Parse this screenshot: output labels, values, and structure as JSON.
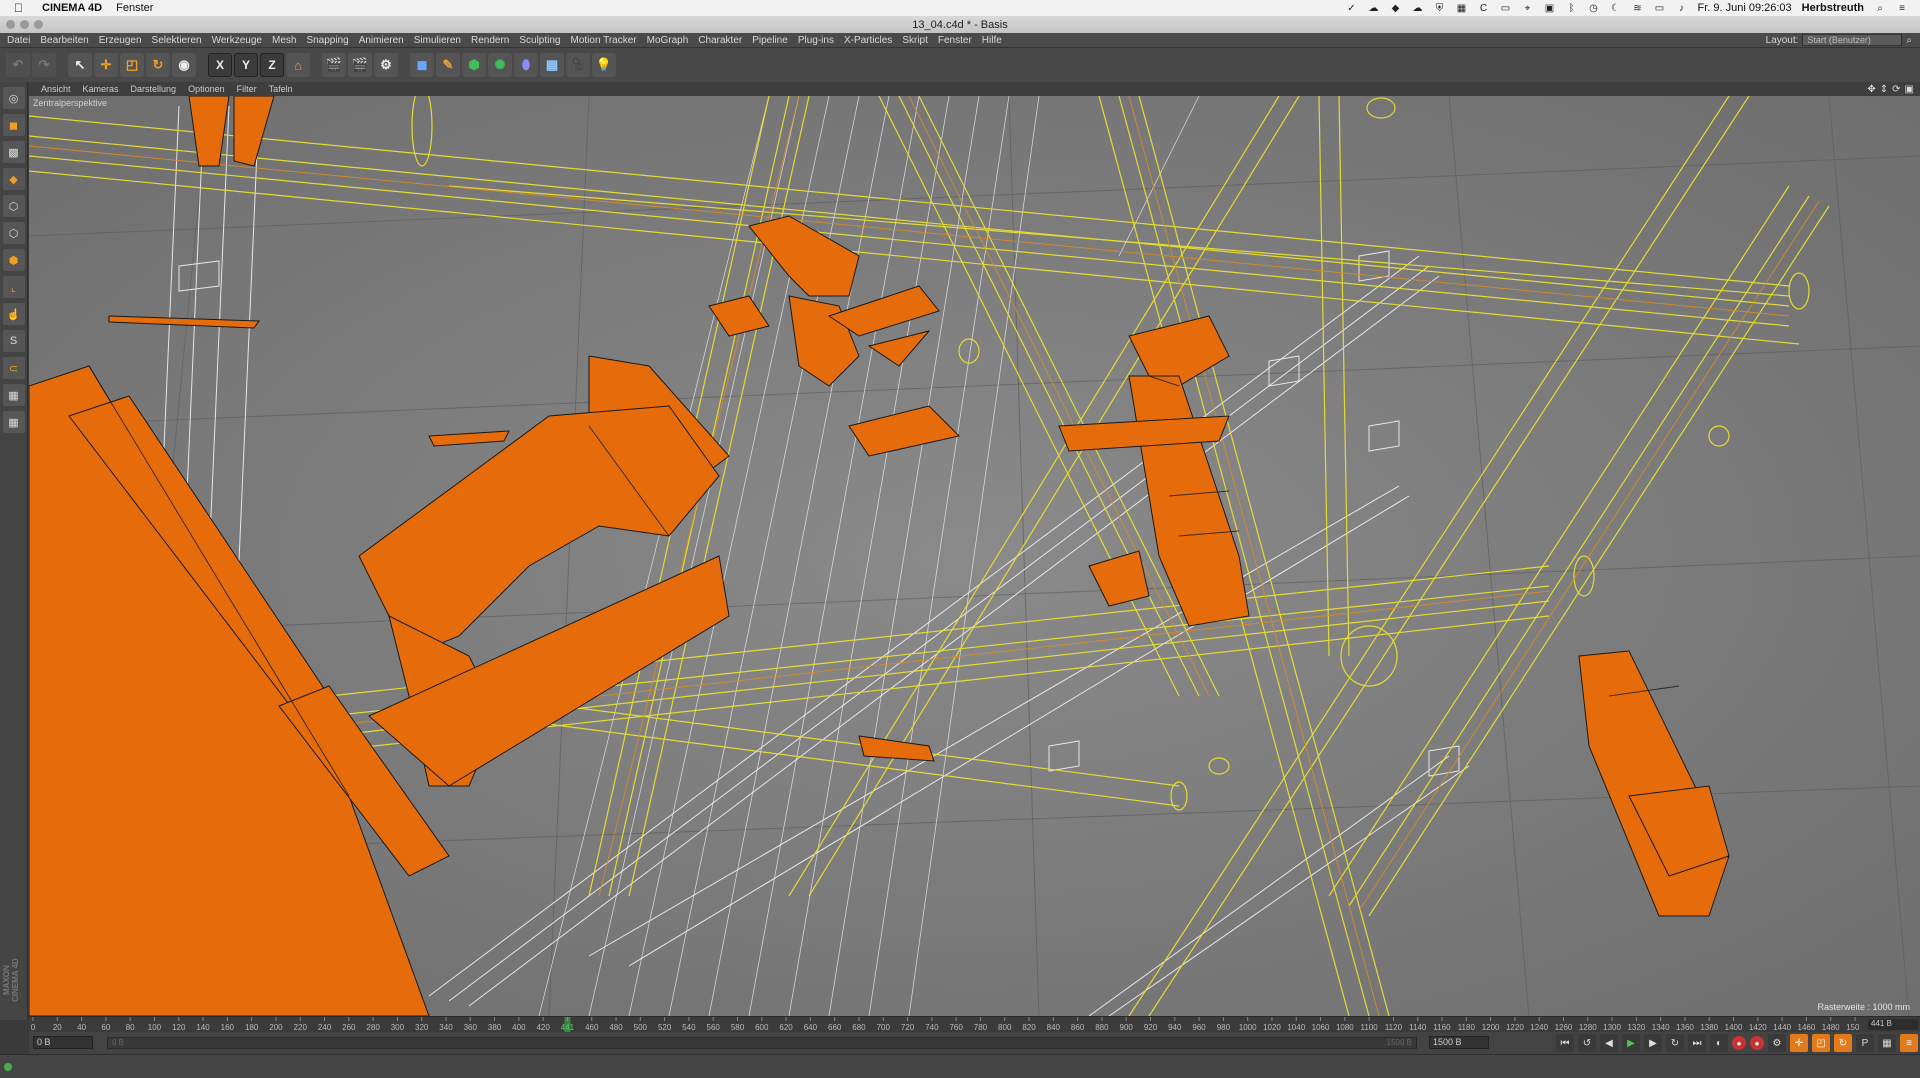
{
  "macos": {
    "app_name": "CINEMA 4D",
    "menu": [
      "Fenster"
    ],
    "status": {
      "date_time": "Fr. 9. Juni 09:26:03",
      "user": "Herbstreuth"
    }
  },
  "window": {
    "title": "13_04.c4d * - Basis"
  },
  "menu": {
    "items": [
      "Datei",
      "Bearbeiten",
      "Erzeugen",
      "Selektieren",
      "Werkzeuge",
      "Mesh",
      "Snapping",
      "Animieren",
      "Simulieren",
      "Rendern",
      "Sculpting",
      "Motion Tracker",
      "MoGraph",
      "Charakter",
      "Pipeline",
      "Plug-ins",
      "X-Particles",
      "Skript",
      "Fenster",
      "Hilfe"
    ],
    "layout_label": "Layout:",
    "layout_value": "Start (Benutzer)"
  },
  "toolbar": {
    "undo": "↶",
    "redo": "↷",
    "axis_x": "X",
    "axis_y": "Y",
    "axis_z": "Z"
  },
  "viewport": {
    "menu": [
      "Ansicht",
      "Kameras",
      "Darstellung",
      "Optionen",
      "Filter",
      "Tafeln"
    ],
    "camera_label": "Zentralperspektive",
    "grid_label": "Rasterweite : 1000 mm",
    "colors": {
      "background": "#7a7a7a",
      "object": "#e66b0a",
      "wire_yellow": "#e9e030",
      "wire_orange": "#d98a2a",
      "wire_white": "#f2f2f2"
    }
  },
  "timeline": {
    "ticks": [
      "0",
      "20",
      "40",
      "60",
      "80",
      "100",
      "120",
      "140",
      "160",
      "180",
      "200",
      "220",
      "240",
      "260",
      "280",
      "300",
      "320",
      "340",
      "360",
      "380",
      "400",
      "420",
      "441",
      "460",
      "480",
      "500",
      "520",
      "540",
      "560",
      "580",
      "600",
      "620",
      "640",
      "660",
      "680",
      "700",
      "720",
      "740",
      "760",
      "780",
      "800",
      "820",
      "840",
      "860",
      "880",
      "900",
      "920",
      "940",
      "960",
      "980",
      "1000",
      "1020",
      "1040",
      "1060",
      "1080",
      "1100",
      "1120",
      "1140",
      "1160",
      "1180",
      "1200",
      "1220",
      "1240",
      "1260",
      "1280",
      "1300",
      "1320",
      "1340",
      "1360",
      "1380",
      "1400",
      "1420",
      "1440",
      "1460",
      "1480",
      "1500"
    ],
    "current_frame": "441",
    "current_frame_field": "441 B"
  },
  "transport": {
    "start_field": "0 B",
    "range_field": "0 B",
    "range_max": "1500 B",
    "end_field": "1500 B"
  },
  "branding": "MAXON CINEMA 4D"
}
